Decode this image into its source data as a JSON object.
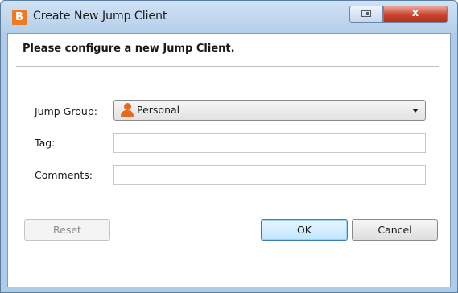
{
  "window": {
    "title": "Create New Jump Client",
    "app_icon_letter": "B",
    "close_glyph": "x"
  },
  "dialog": {
    "heading": "Please configure a new Jump Client."
  },
  "form": {
    "jump_group": {
      "label": "Jump Group:",
      "value": "Personal",
      "icon": "person-icon"
    },
    "tag": {
      "label": "Tag:",
      "value": ""
    },
    "comments": {
      "label": "Comments:",
      "value": ""
    }
  },
  "buttons": {
    "reset": "Reset",
    "ok": "OK",
    "cancel": "Cancel"
  },
  "colors": {
    "app_icon": "#f07a21",
    "close_button": "#c9452f",
    "ok_border": "#3c7fb1",
    "person_icon": "#e36a1f"
  }
}
